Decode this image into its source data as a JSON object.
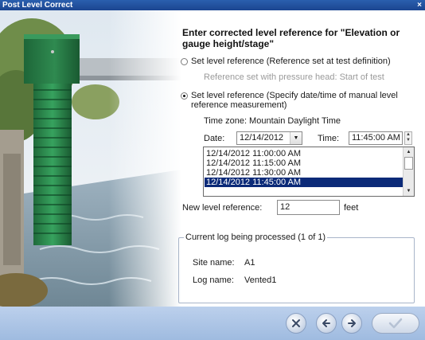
{
  "window": {
    "title": "Post Level Correct"
  },
  "heading": "Enter corrected level reference for \"Elevation or gauge height/stage\"",
  "option1": {
    "label": "Set level reference (Reference set at test definition)",
    "sublabel": "Reference set with pressure head: Start of test",
    "selected": false
  },
  "option2": {
    "label_line1": "Set level reference (Specify date/time of manual level",
    "label_line2": "reference measurement)",
    "selected": true
  },
  "timezone": "Time zone: Mountain Daylight Time",
  "date": {
    "label": "Date:",
    "value": "12/14/2012"
  },
  "time": {
    "label": "Time:",
    "value": "11:45:00 AM"
  },
  "timestamps": [
    "12/14/2012 11:00:00 AM",
    "12/14/2012 11:15:00 AM",
    "12/14/2012 11:30:00 AM",
    "12/14/2012 11:45:00 AM"
  ],
  "selected_timestamp": "12/14/2012 11:45:00 AM",
  "new_level": {
    "label": "New level reference:",
    "value": "12",
    "unit": "feet"
  },
  "log_group": {
    "title": "Current log being processed (1 of 1)",
    "site_label": "Site name:",
    "site_value": "A1",
    "log_label": "Log name:",
    "log_value": "Vented1"
  },
  "buttons": [
    "cancel-icon",
    "back-arrow-icon",
    "next-arrow-icon",
    "checkmark-icon"
  ]
}
